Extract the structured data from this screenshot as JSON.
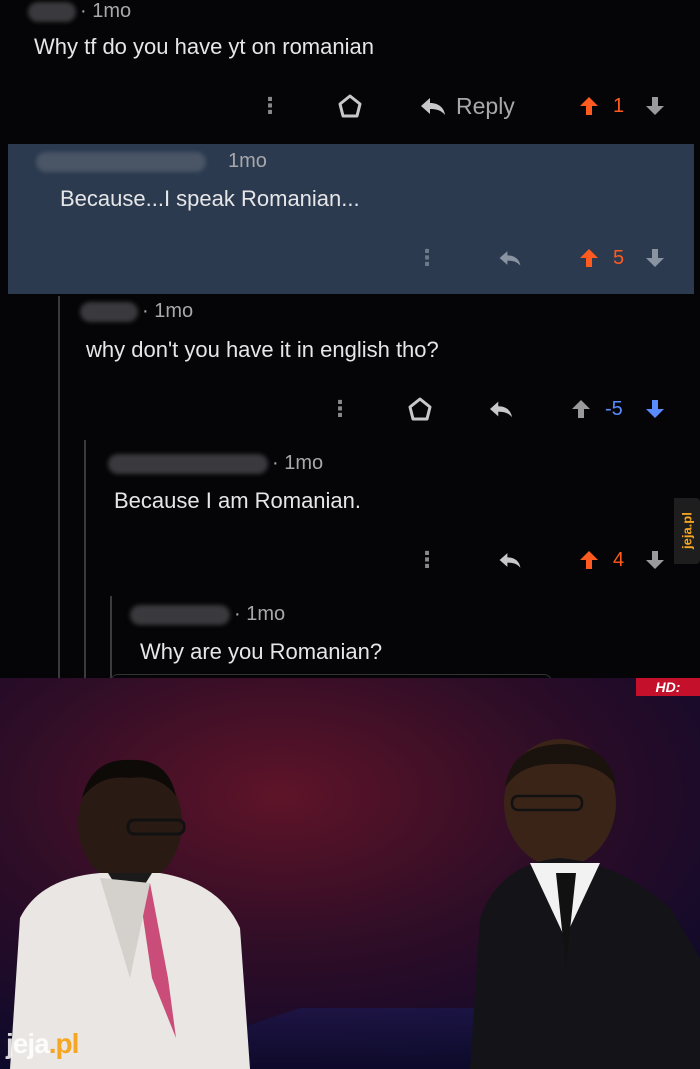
{
  "comments": [
    {
      "age": "· 1mo",
      "text": "Why tf do you have yt on romanian",
      "reply_label": "Reply",
      "score": "1"
    },
    {
      "age": "1mo",
      "text": "Because...I speak Romanian...",
      "score": "5"
    },
    {
      "age": "· 1mo",
      "text": "why don't you have it in english tho?",
      "score": "-5"
    },
    {
      "age": "· 1mo",
      "text": "Because I am Romanian.",
      "score": "4"
    },
    {
      "age": "· 1mo",
      "text": "Why are you Romanian?"
    }
  ],
  "watermark": {
    "site": "jeja",
    "tld": ".pl",
    "side_label": "jeja.pl"
  },
  "tv_badge": "HD:",
  "colors": {
    "upvote": "#ff5a1f",
    "downvote": "#5a8bff",
    "highlight": "#2b3a4f",
    "text": "#e6e6e8",
    "meta": "#a8a8ab"
  }
}
